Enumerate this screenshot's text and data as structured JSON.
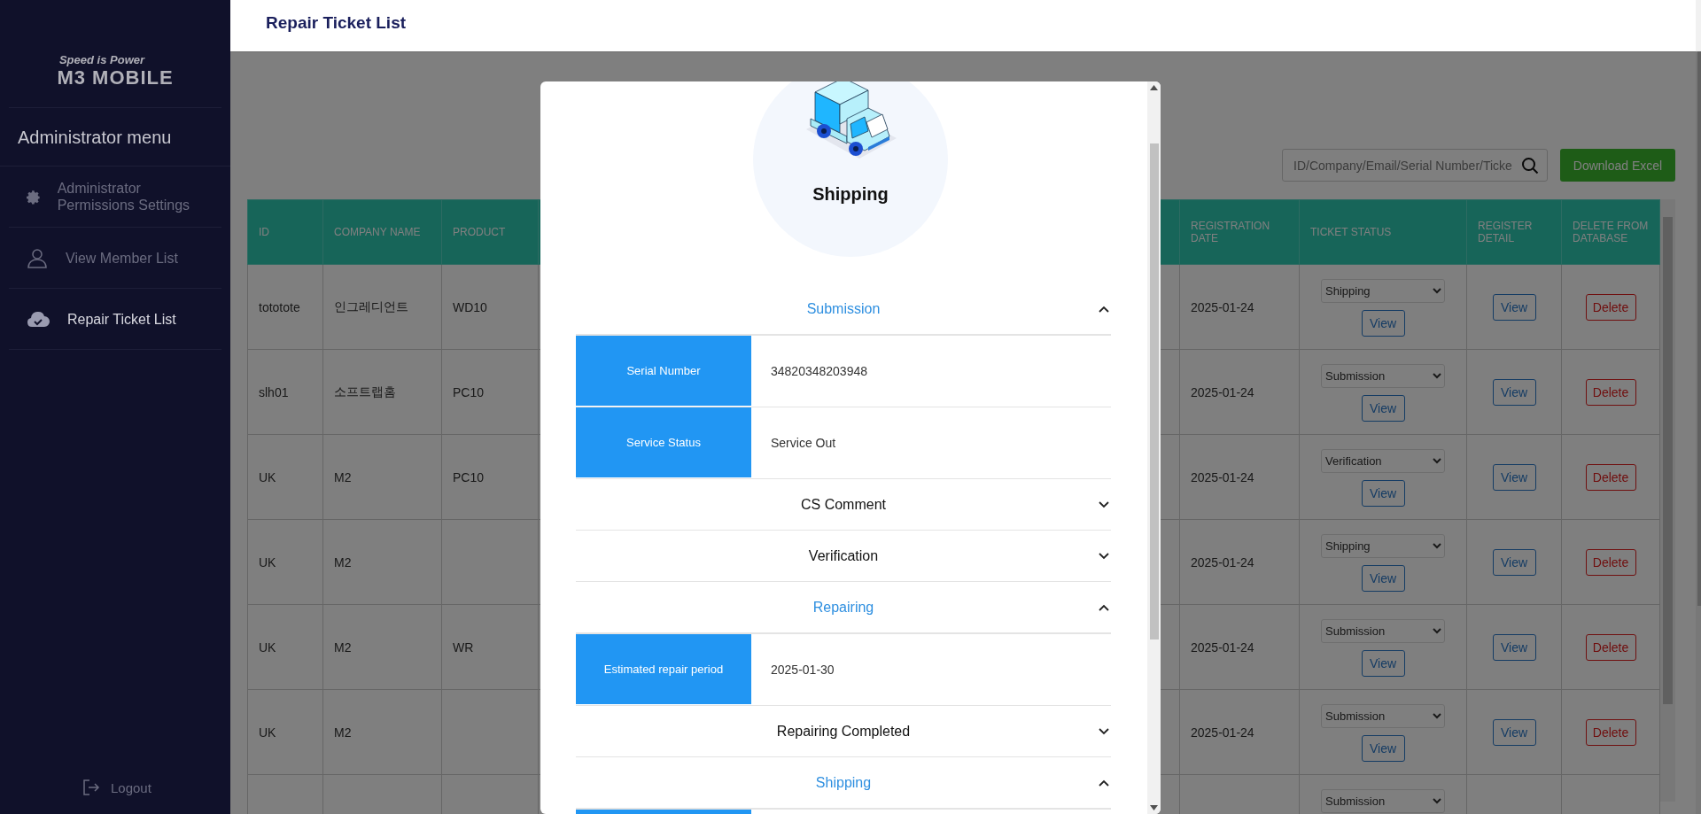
{
  "sidebar": {
    "tagline": "Speed is Power",
    "logo": "M3 MOBILE",
    "menu_title": "Administrator menu",
    "items": [
      {
        "label": "Administrator Permissions Settings",
        "selected": false
      },
      {
        "label": "View Member List",
        "selected": false
      },
      {
        "label": "Repair Ticket List",
        "selected": true
      }
    ],
    "logout": "Logout"
  },
  "header": {
    "title": "Repair Ticket List"
  },
  "toolbar": {
    "search": {
      "placeholder": "ID/Company/Email/Serial Number/Ticke"
    },
    "download_button": "Download Excel"
  },
  "table": {
    "columns": [
      {
        "kind": "text",
        "label": "ID"
      },
      {
        "kind": "text",
        "label": "COMPANY NAME"
      },
      {
        "kind": "text",
        "label": "PRODUCT"
      },
      {
        "kind": "hidden"
      },
      {
        "kind": "text",
        "label": "REGISTRATION DATE"
      },
      {
        "kind": "status",
        "label": "TICKET STATUS"
      },
      {
        "kind": "detail",
        "label": "REGISTER DETAIL"
      },
      {
        "kind": "delete",
        "label": "DELETE FROM DATABASE"
      }
    ],
    "rows": [
      {
        "cells": [
          "tototote",
          "인그레디언트",
          "WD10",
          "2025-01-24"
        ],
        "status": "Shipping",
        "status_button": "View",
        "detail_button": "View",
        "delete_button": "Delete"
      },
      {
        "cells": [
          "slh01",
          "소프트랩홈",
          "PC10",
          "2025-01-24"
        ],
        "status": "Submission",
        "status_button": "View",
        "detail_button": "View",
        "delete_button": "Delete"
      },
      {
        "cells": [
          "UK",
          "M2",
          "PC10",
          "2025-01-24"
        ],
        "status": "Verification",
        "status_button": "View",
        "detail_button": "View",
        "delete_button": "Delete"
      },
      {
        "cells": [
          "UK",
          "M2",
          null,
          "2025-01-24"
        ],
        "status": "Shipping",
        "status_button": "View",
        "detail_button": "View",
        "delete_button": "Delete"
      },
      {
        "cells": [
          "UK",
          "M2",
          "WR",
          "2025-01-24"
        ],
        "status": "Submission",
        "status_button": "View",
        "detail_button": "View",
        "delete_button": "Delete"
      },
      {
        "cells": [
          "UK",
          "M2",
          null,
          "2025-01-24"
        ],
        "status": "Submission",
        "status_button": "View",
        "detail_button": "View",
        "delete_button": "Delete"
      },
      {
        "status": "Submission"
      }
    ]
  },
  "modal": {
    "status_title": "Shipping",
    "sections": [
      {
        "title": "Submission",
        "expanded": true,
        "rows": [
          {
            "label": "Serial Number",
            "value": "34820348203948"
          },
          {
            "label": "Service Status",
            "value": "Service Out"
          }
        ]
      },
      {
        "title": "CS Comment",
        "expanded": false
      },
      {
        "title": "Verification",
        "expanded": false
      },
      {
        "title": "Repairing",
        "expanded": true,
        "rows": [
          {
            "label": "Estimated repair period",
            "value": "2025-01-30"
          }
        ]
      },
      {
        "title": "Repairing Completed",
        "expanded": false
      },
      {
        "title": "Shipping",
        "expanded": true,
        "rows_cut_off": true
      }
    ]
  }
}
